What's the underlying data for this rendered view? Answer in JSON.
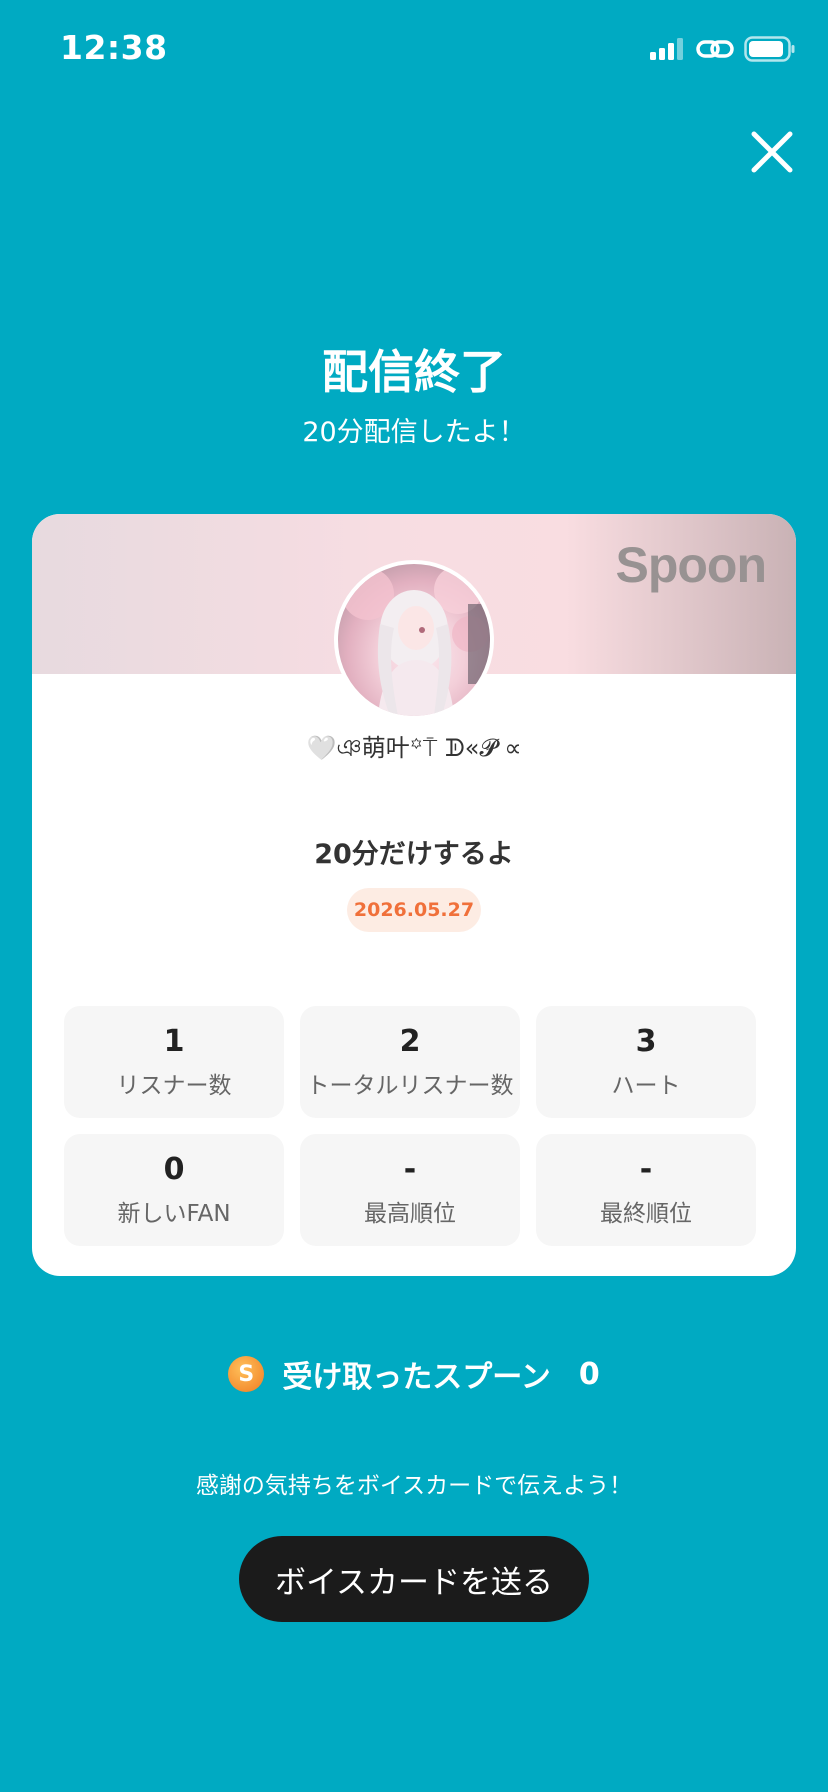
{
  "status_bar": {
    "time": "12:38",
    "icons": [
      "signal-icon",
      "link-icon",
      "battery-icon"
    ]
  },
  "header": {
    "close_icon": "close-icon",
    "title": "配信終了",
    "subtitle": "20分配信したよ！"
  },
  "card": {
    "brand": "Spoon",
    "nickname": "🤍ঞ萌叶꙳⍑ ᗫ«𝓟 ∝",
    "broadcast_title": "20分だけするよ",
    "date": "2026.05.27",
    "stats": [
      {
        "value": "1",
        "label": "リスナー数"
      },
      {
        "value": "2",
        "label": "トータルリスナー数"
      },
      {
        "value": "3",
        "label": "ハート"
      },
      {
        "value": "0",
        "label": "新しいFAN"
      },
      {
        "value": "-",
        "label": "最高順位"
      },
      {
        "value": "-",
        "label": "最終順位"
      }
    ]
  },
  "spoons": {
    "coin_letter": "S",
    "label": "受け取ったスプーン",
    "count": "0"
  },
  "footer": {
    "thanks_text": "感謝の気持ちをボイスカードで伝えよう！",
    "voice_card_button": "ボイスカードを送る"
  },
  "colors": {
    "background": "#00aac2",
    "date_accent": "#f0703a",
    "button_bg": "#1b1b1b"
  }
}
